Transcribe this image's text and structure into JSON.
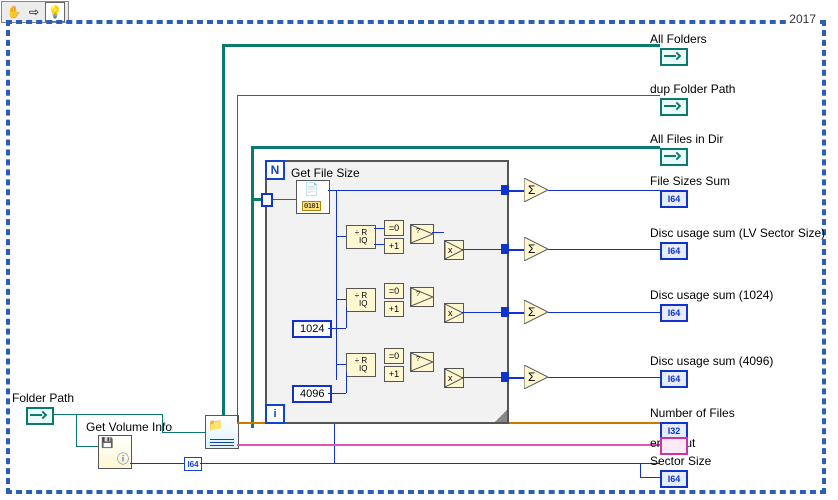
{
  "meta": {
    "version": "2017"
  },
  "toolbar": {
    "pan_tip": "Pan",
    "break_tip": "Arrow",
    "highlight_tip": "Highlight"
  },
  "controls": {
    "folder_path_label": "Folder Path"
  },
  "indicators": {
    "all_folders": "All Folders",
    "dup_folder_path": "dup Folder Path",
    "all_files_in_dir": "All Files in Dir",
    "file_sizes_sum": "File Sizes Sum",
    "disc_usage_sum_lv": "Disc usage sum (LV Sector Size)",
    "disc_usage_sum_1024": "Disc usage sum (1024)",
    "disc_usage_sum_4096": "Disc usage sum (4096)",
    "number_of_files": "Number of Files",
    "error_out": "error out",
    "sector_size": "Sector Size"
  },
  "subvis": {
    "get_volume_info": "Get Volume Info",
    "list_folder": "List Folder",
    "get_file_size": "Get File Size"
  },
  "constants": {
    "c1024": "1024",
    "c4096": "4096"
  },
  "loop": {
    "n_label": "N",
    "i_label": "i"
  },
  "prim_labels": {
    "qr": "÷ R\n  IQ",
    "eq0": "=0",
    "inc": "+1",
    "mul": "x",
    "sum": "Σ",
    "i64_coerce": "I64"
  },
  "terminal_types": {
    "i64_text": "I64",
    "i32_text": "I32"
  }
}
